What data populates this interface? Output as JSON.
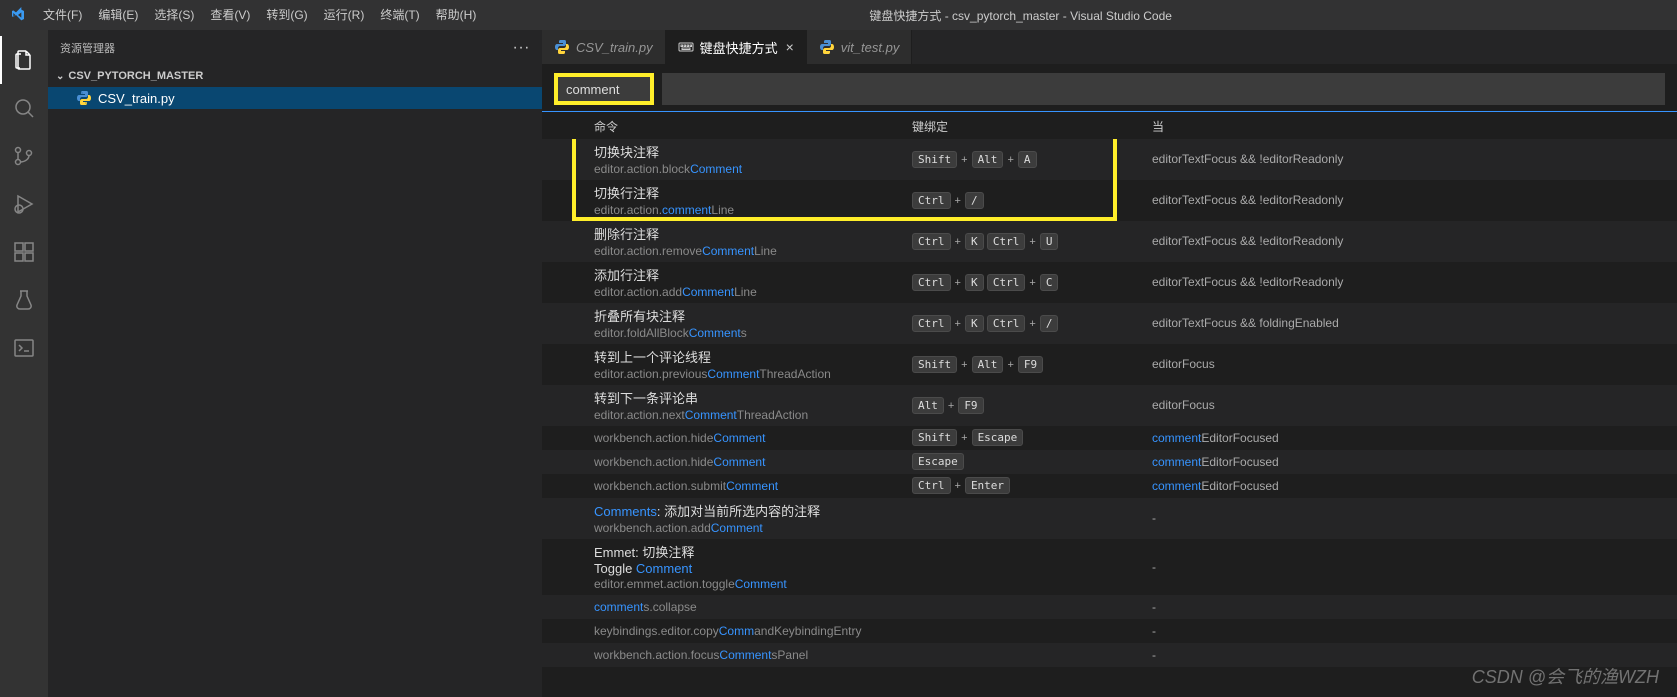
{
  "window_title": "键盘快捷方式 - csv_pytorch_master - Visual Studio Code",
  "menu": [
    "文件(F)",
    "编辑(E)",
    "选择(S)",
    "查看(V)",
    "转到(G)",
    "运行(R)",
    "终端(T)",
    "帮助(H)"
  ],
  "sidebar": {
    "title": "资源管理器",
    "dots": "···",
    "section": "CSV_PYTORCH_MASTER",
    "files": [
      "CSV_train.py"
    ]
  },
  "tabs": [
    {
      "label": "CSV_train.py",
      "type": "py"
    },
    {
      "label": "键盘快捷方式",
      "type": "ks",
      "active": true
    },
    {
      "label": "vit_test.py",
      "type": "py"
    }
  ],
  "search_value": "comment",
  "headers": {
    "cmd": "命令",
    "key": "键绑定",
    "when": "当"
  },
  "rows": [
    {
      "title": "切换块注释",
      "idp": "editor.action.block",
      "idk": "Comment",
      "ids": "",
      "keys": [
        [
          "Shift",
          "Alt",
          "A"
        ]
      ],
      "when": "editorTextFocus && !editorReadonly",
      "tall": true
    },
    {
      "title": "切换行注释",
      "idp": "editor.action.",
      "idk": "comment",
      "ids": "Line",
      "keys": [
        [
          "Ctrl",
          "/"
        ]
      ],
      "when": "editorTextFocus && !editorReadonly",
      "tall": true
    },
    {
      "title": "删除行注释",
      "idp": "editor.action.remove",
      "idk": "Comment",
      "ids": "Line",
      "keys": [
        [
          "Ctrl",
          "K"
        ],
        [
          "Ctrl",
          "U"
        ]
      ],
      "when": "editorTextFocus && !editorReadonly",
      "tall": true
    },
    {
      "title": "添加行注释",
      "idp": "editor.action.add",
      "idk": "Comment",
      "ids": "Line",
      "keys": [
        [
          "Ctrl",
          "K"
        ],
        [
          "Ctrl",
          "C"
        ]
      ],
      "when": "editorTextFocus && !editorReadonly",
      "tall": true
    },
    {
      "title": "折叠所有块注释",
      "idp": "editor.foldAllBlock",
      "idk": "Comment",
      "ids": "s",
      "keys": [
        [
          "Ctrl",
          "K"
        ],
        [
          "Ctrl",
          "/"
        ]
      ],
      "when": "editorTextFocus && foldingEnabled",
      "tall": true
    },
    {
      "title": "转到上一个评论线程",
      "idp": "editor.action.previous",
      "idk": "Comment",
      "ids": "ThreadAction",
      "keys": [
        [
          "Shift",
          "Alt",
          "F9"
        ]
      ],
      "when": "editorFocus",
      "tall": true
    },
    {
      "title": "转到下一条评论串",
      "idp": "editor.action.next",
      "idk": "Comment",
      "ids": "ThreadAction",
      "keys": [
        [
          "Alt",
          "F9"
        ]
      ],
      "when": "editorFocus",
      "tall": true
    },
    {
      "title": "",
      "idp": "workbench.action.hide",
      "idk": "Comment",
      "ids": "",
      "keys": [
        [
          "Shift",
          "Escape"
        ]
      ],
      "when_pre": "comment",
      "when": "EditorFocused"
    },
    {
      "title": "",
      "idp": "workbench.action.hide",
      "idk": "Comment",
      "ids": "",
      "keys": [
        [
          "Escape"
        ]
      ],
      "when_pre": "comment",
      "when": "EditorFocused",
      "pencil": true
    },
    {
      "title": "",
      "idp": "workbench.action.submit",
      "idk": "Comment",
      "ids": "",
      "keys": [
        [
          "Ctrl",
          "Enter"
        ]
      ],
      "when_pre": "comment",
      "when": "EditorFocused"
    },
    {
      "title_kw": "Comments",
      "title": ": 添加对当前所选内容的注释",
      "idp": "workbench.action.add",
      "idk": "Comment",
      "ids": "",
      "keys": [],
      "when": "-",
      "tall": true
    },
    {
      "title": "Emmet: 切换注释",
      "idp2line": "Toggle ",
      "idp2kw": "Comment",
      "idp": "editor.emmet.action.toggle",
      "idk": "Comment",
      "ids": "",
      "keys": [],
      "when": "-",
      "emmet": true
    },
    {
      "title": "",
      "idp": "",
      "idk": "comment",
      "ids": "s.collapse",
      "keys": [],
      "when": "-"
    },
    {
      "title": "",
      "idp": "keybindings.editor.copy",
      "idk": "Comm",
      "ids": "andKeybindingEntry",
      "keys": [],
      "when": "-",
      "idk2": "ry"
    },
    {
      "title": "",
      "idp": "workbench.action.focus",
      "idk": "Comment",
      "ids": "sPanel",
      "keys": [],
      "when": "-"
    }
  ],
  "watermark": "CSDN @会飞的渔WZH"
}
